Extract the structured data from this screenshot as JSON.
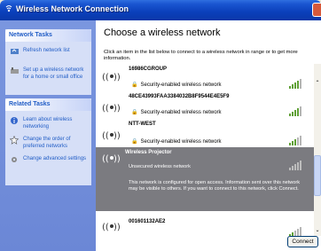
{
  "window": {
    "title": "Wireless Network Connection"
  },
  "tasks": {
    "network_tasks_heading": "Network Tasks",
    "network_tasks": [
      {
        "label": "Refresh network list",
        "icon": "refresh-icon"
      },
      {
        "label": "Set up a wireless network for a home or small office",
        "icon": "setup-network-icon"
      }
    ],
    "related_tasks_heading": "Related Tasks",
    "related_tasks": [
      {
        "label": "Learn about wireless networking",
        "icon": "info-icon"
      },
      {
        "label": "Change the order of preferred networks",
        "icon": "star-icon"
      },
      {
        "label": "Change advanced settings",
        "icon": "settings-icon"
      }
    ]
  },
  "main": {
    "title": "Choose a wireless network",
    "description": "Click an item in the list below to connect to a wireless network in range or to get more information."
  },
  "networks": [
    {
      "name": "16986CGROUP",
      "security": "Security-enabled wireless network",
      "signal": 4
    },
    {
      "name": "48CE43993FAA3384032B8F9544E4E5F9",
      "security": "Security-enabled wireless network",
      "signal": 4
    },
    {
      "name": "NTT-WEST",
      "security": "Security-enabled wireless network",
      "signal": 3
    },
    {
      "name": "Wireless Projector",
      "security": "Unsecured wireless network",
      "signal": 5,
      "selected": true,
      "details": "This network is configured for open access. Information sent over this network may be visible to others. If you want to connect to this network, click Connect."
    },
    {
      "name": "001601132AE2",
      "security": "",
      "signal": 2
    }
  ],
  "buttons": {
    "connect": "Connect"
  },
  "colors": {
    "titlebar": "#0a3fba",
    "task_pane": "#6b87d6",
    "selection": "#7b7b80",
    "signal_on": "#5fa035"
  }
}
